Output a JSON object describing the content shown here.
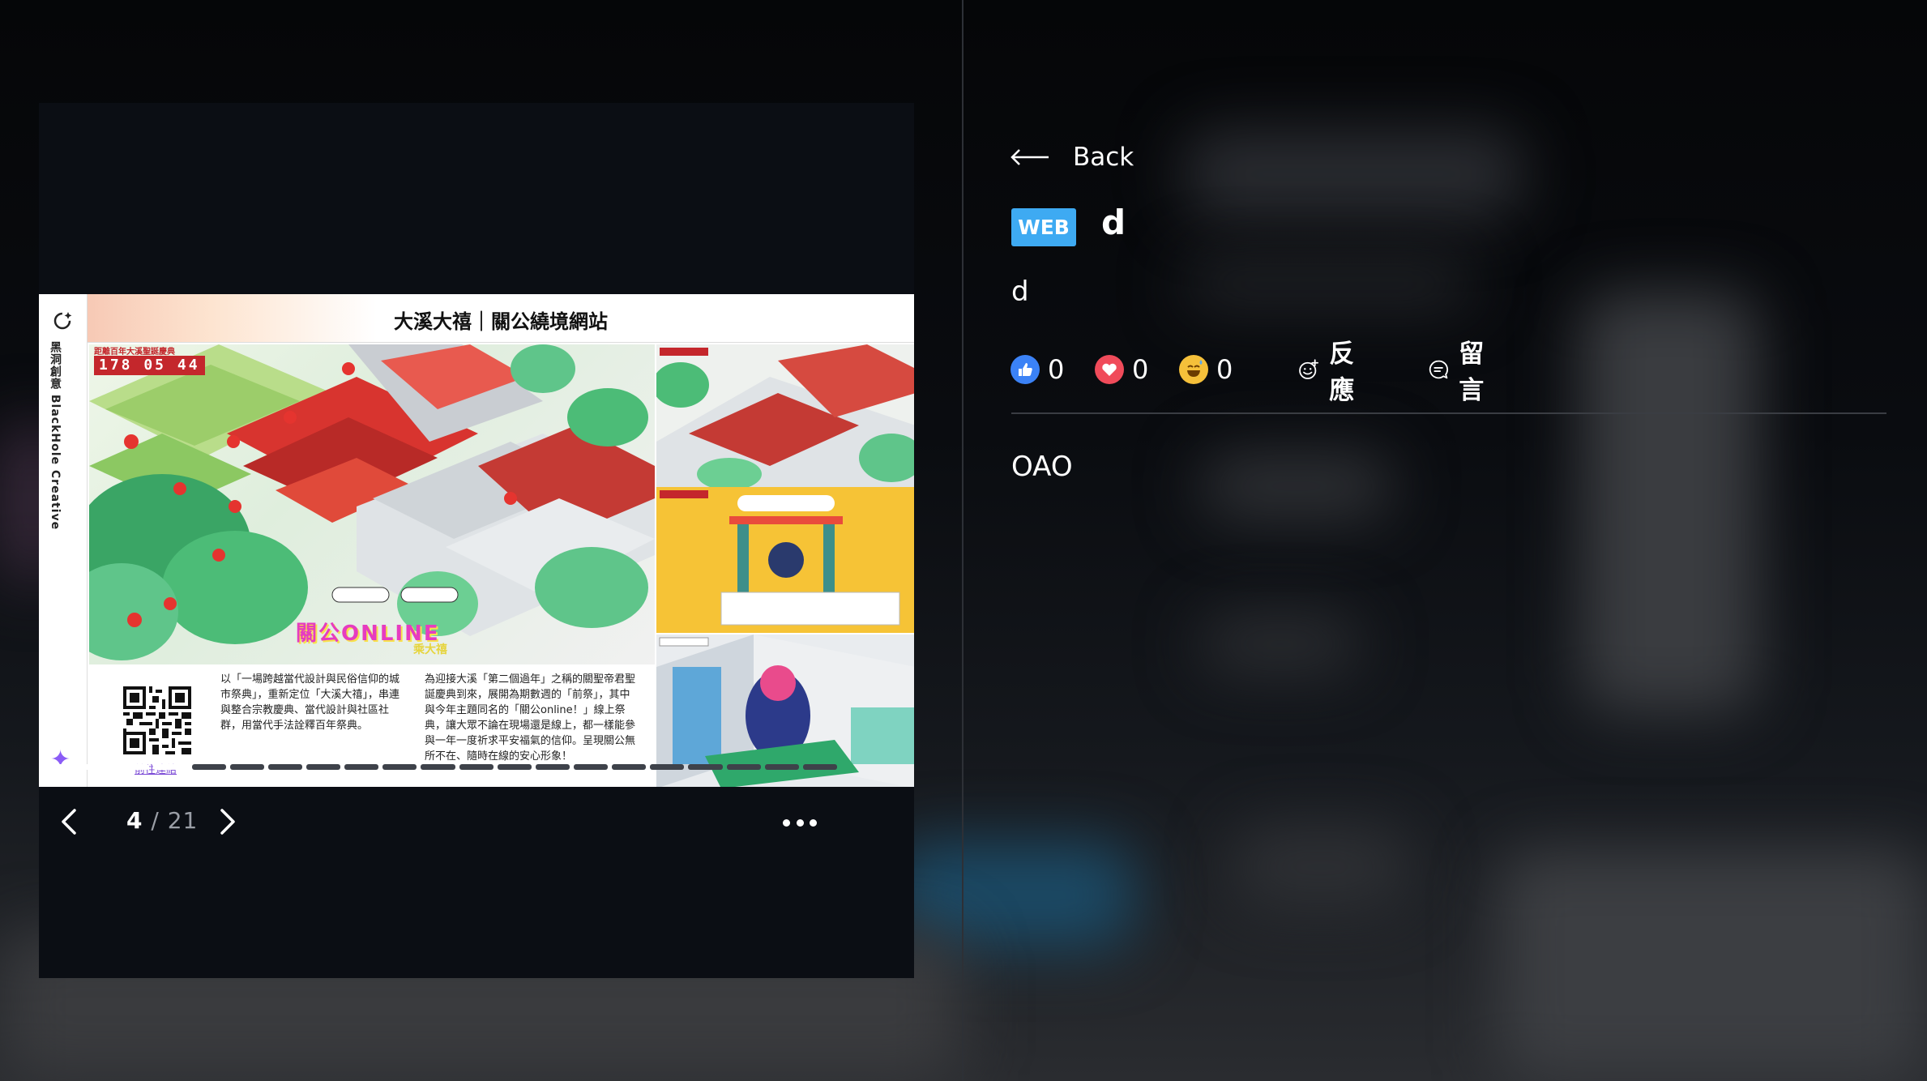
{
  "viewer": {
    "slide": {
      "title": "大溪大禧｜關公繞境網站",
      "brand_cn": "黑洞創意",
      "brand_en": "BlackHole Creative",
      "counter_caption": "距離百年大溪聖誕慶典",
      "counter_value": "178 05 44",
      "online_logo": "關公ONLINE",
      "online_sub": "乘大禧",
      "qr_link": "前往連結",
      "description_1": "以「一場跨越當代設計與民俗信仰的城市祭典」，重新定位「大溪大禧」，串連與整合宗教慶典、當代設計與社區社群，用當代手法詮釋百年祭典。",
      "description_2": "為迎接大溪「第二個過年」之稱的關聖帝君聖誕慶典到來，展開為期數週的「前祭」，其中與今年主題同名的「關公online！」線上祭典，讓大眾不論在現場還是線上，都一樣能參與一年一度祈求平安福氣的信仰。呈現關公無所不在、隨時在線的安心形象！"
    },
    "progress": {
      "total": 21,
      "completed": 4
    },
    "pager": {
      "current": "4",
      "separator": " / ",
      "total": "21"
    },
    "icons": {
      "prev": "chevron-left-icon",
      "next": "chevron-right-icon",
      "more": "more-dots-icon"
    }
  },
  "post": {
    "back_label": "Back",
    "tag": "WEB",
    "title": "d",
    "subtitle": "d",
    "reactions": [
      {
        "icon": "thumbs-up-icon",
        "count": "0",
        "color": "#3b82f6"
      },
      {
        "icon": "heart-icon",
        "count": "0",
        "color": "#f04b5a"
      },
      {
        "icon": "laugh-sweat-icon",
        "count": "0",
        "color": "#f5c03a"
      }
    ],
    "react_label": "反應",
    "comment_label": "留言",
    "content": "OAO"
  },
  "colors": {
    "accent": "#3eaaf2",
    "progress_done": "#ffffff",
    "progress_todo": "#3e424a"
  }
}
